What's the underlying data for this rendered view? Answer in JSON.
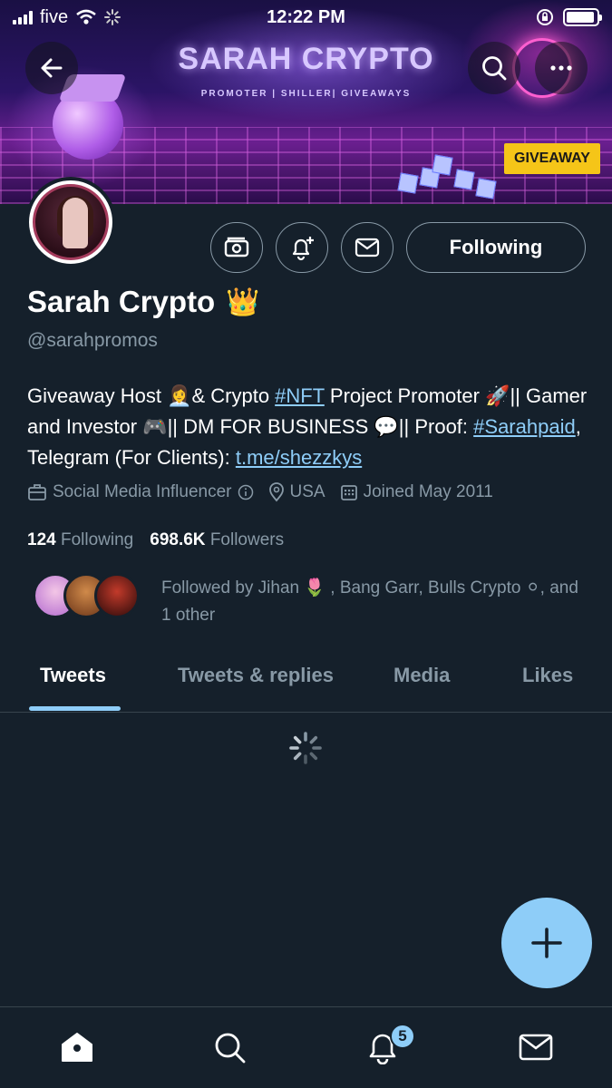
{
  "status_bar": {
    "carrier": "five",
    "time": "12:22 PM",
    "battery_level": 0.95
  },
  "banner": {
    "title": "SARAH CRYPTO",
    "subtitle": "PROMOTER | SHILLER| GIVEAWAYS",
    "badge": "GIVEAWAY"
  },
  "header_buttons": {
    "back_icon": "arrow-left-icon",
    "search_icon": "search-icon",
    "more_icon": "more-horizontal-icon"
  },
  "profile": {
    "display_name": "Sarah Crypto",
    "name_emoji": "👑",
    "handle": "@sarahpromos",
    "following_label": "Following",
    "bio": {
      "part1": "Giveaway Host ",
      "emoji_host": "👩‍💼",
      "part2": "& Crypto ",
      "hashtag_nft": "#NFT",
      "part3": " Project Promoter ",
      "emoji_rocket": "🚀",
      "part4": "|| Gamer and Investor ",
      "emoji_game": "🎮",
      "part5": "|| DM FOR BUSINESS ",
      "emoji_speech": "💬",
      "part6": "|| Proof: ",
      "hashtag_paid": "#Sarahpaid",
      "part7": ", Telegram (For Clients): ",
      "link_telegram": "t.me/shezzkys"
    },
    "category": "Social Media Influencer",
    "location": "USA",
    "joined": "Joined May 2011",
    "following_count": "124",
    "following_text": "Following",
    "followers_count": "698.6K",
    "followers_text": "Followers",
    "followed_by": "Followed by Jihan 🌷 , Bang Garr, Bulls Crypto ⚪, and 1 other"
  },
  "tabs": [
    {
      "label": "Tweets",
      "active": true
    },
    {
      "label": "Tweets & replies",
      "active": false
    },
    {
      "label": "Media",
      "active": false
    },
    {
      "label": "Likes",
      "active": false
    }
  ],
  "bottom_nav": {
    "home_icon": "home-icon",
    "search_icon": "search-icon",
    "notifications_icon": "bell-icon",
    "notifications_badge": "5",
    "messages_icon": "mail-icon"
  },
  "colors": {
    "background": "#15202b",
    "accent": "#8ecdf8",
    "secondary_text": "#8899a6",
    "border": "#38444d"
  }
}
